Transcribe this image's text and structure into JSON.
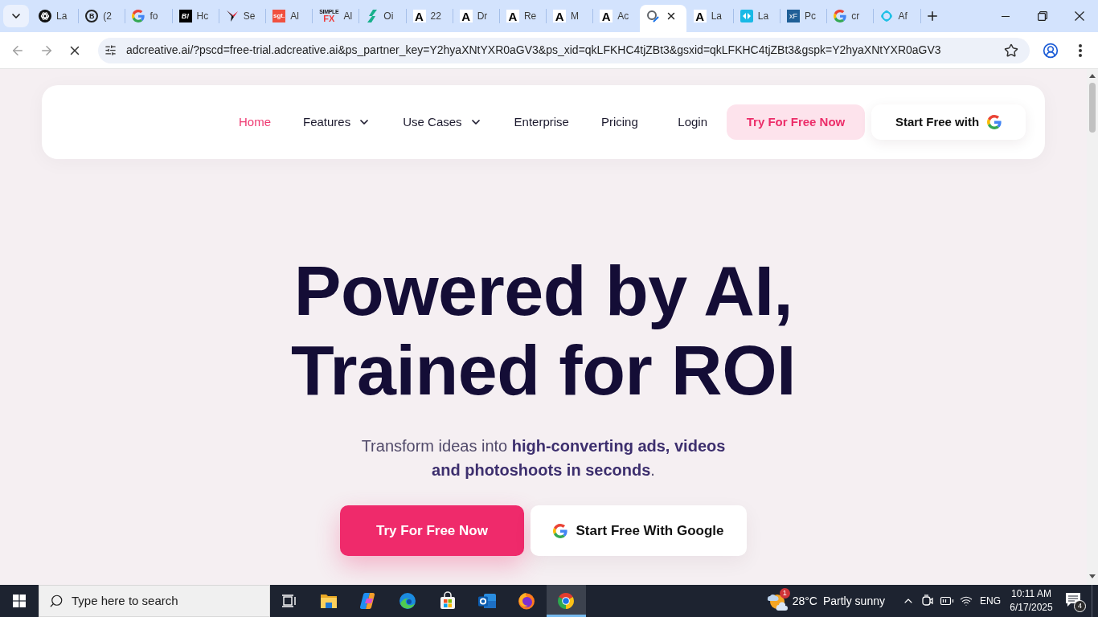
{
  "browser": {
    "tabs": [
      {
        "title": "La",
        "favicon": {
          "kind": "knot"
        },
        "selected": false
      },
      {
        "title": "(2",
        "favicon": {
          "kind": "ring-letter",
          "text": "B"
        },
        "selected": false
      },
      {
        "title": "fo",
        "favicon": {
          "kind": "g-logo"
        },
        "selected": false
      },
      {
        "title": "Hc",
        "favicon": {
          "kind": "dark-tile",
          "text": "B!"
        },
        "selected": false
      },
      {
        "title": "Se",
        "favicon": {
          "kind": "star"
        },
        "selected": false
      },
      {
        "title": "Al",
        "favicon": {
          "kind": "red-tile",
          "text": "sgt."
        },
        "selected": false
      },
      {
        "title": "Al",
        "favicon": {
          "kind": "stacked",
          "caption": "SIMPLE",
          "text": "FX"
        },
        "selected": false
      },
      {
        "title": "Oi",
        "favicon": {
          "kind": "s-mark"
        },
        "selected": false
      },
      {
        "title": "22",
        "favicon": {
          "kind": "letter",
          "text": "A"
        },
        "selected": false
      },
      {
        "title": "Dr",
        "favicon": {
          "kind": "letter",
          "text": "A"
        },
        "selected": false
      },
      {
        "title": "Re",
        "favicon": {
          "kind": "letter",
          "text": "A"
        },
        "selected": false
      },
      {
        "title": "M",
        "favicon": {
          "kind": "letter",
          "text": "A"
        },
        "selected": false
      },
      {
        "title": "Ac",
        "favicon": {
          "kind": "letter",
          "text": "A"
        },
        "selected": false
      },
      {
        "favicon": {
          "kind": "loading"
        },
        "selected": true
      },
      {
        "title": "La",
        "favicon": {
          "kind": "letter",
          "text": "A"
        },
        "selected": false
      },
      {
        "title": "La",
        "favicon": {
          "kind": "arrows"
        },
        "selected": false
      },
      {
        "title": "Pc",
        "favicon": {
          "kind": "blue-tile",
          "text": "xF"
        },
        "selected": false
      },
      {
        "title": "cr",
        "favicon": {
          "kind": "g-logo"
        },
        "selected": false
      },
      {
        "title": "Af",
        "favicon": {
          "kind": "ring"
        },
        "selected": false
      }
    ],
    "address_bar": {
      "url": "adcreative.ai/?pscd=free-trial.adcreative.ai&ps_partner_key=Y2hyaXNtYXR0aGV3&ps_xid=qkLFKHC4tjZBt3&gsxid=qkLFKHC4tjZBt3&gspk=Y2hyaXNtYXR0aGV3"
    }
  },
  "page": {
    "nav": {
      "items": [
        {
          "label": "Home",
          "selected": true,
          "dropdown": false
        },
        {
          "label": "Features",
          "selected": false,
          "dropdown": true
        },
        {
          "label": "Use Cases",
          "selected": false,
          "dropdown": true
        },
        {
          "label": "Enterprise",
          "selected": false,
          "dropdown": false
        },
        {
          "label": "Pricing",
          "selected": false,
          "dropdown": false
        }
      ],
      "login": "Login",
      "buttons": [
        {
          "label": "Try For Free Now",
          "kind": "soft"
        },
        {
          "label": "Start Free with",
          "kind": "google"
        }
      ]
    },
    "hero": {
      "title": "Powered by AI, Trained for ROI",
      "subtitle": "Transform ideas into **high-converting ads, videos and photoshoots in seconds**.",
      "buttons": [
        {
          "label": "Try For Free Now",
          "kind": "primary"
        },
        {
          "label": "Start Free With Google",
          "kind": "google"
        }
      ]
    }
  },
  "taskbar": {
    "search": {
      "placeholder": "Type here to search"
    },
    "apps": [
      {
        "kind": "task-view",
        "selected": false
      },
      {
        "kind": "folder",
        "selected": false
      },
      {
        "kind": "loop",
        "selected": false
      },
      {
        "kind": "swirl",
        "selected": false
      },
      {
        "kind": "bag",
        "selected": false
      },
      {
        "kind": "envelope",
        "selected": false
      },
      {
        "kind": "flame",
        "selected": false
      },
      {
        "kind": "wheel",
        "selected": true
      }
    ],
    "weather": {
      "badge": "1",
      "temperature": "28°C",
      "condition": "Partly sunny"
    },
    "language": "ENG",
    "time": "10:11 AM",
    "date": "6/17/2025",
    "notifications": "4"
  }
}
